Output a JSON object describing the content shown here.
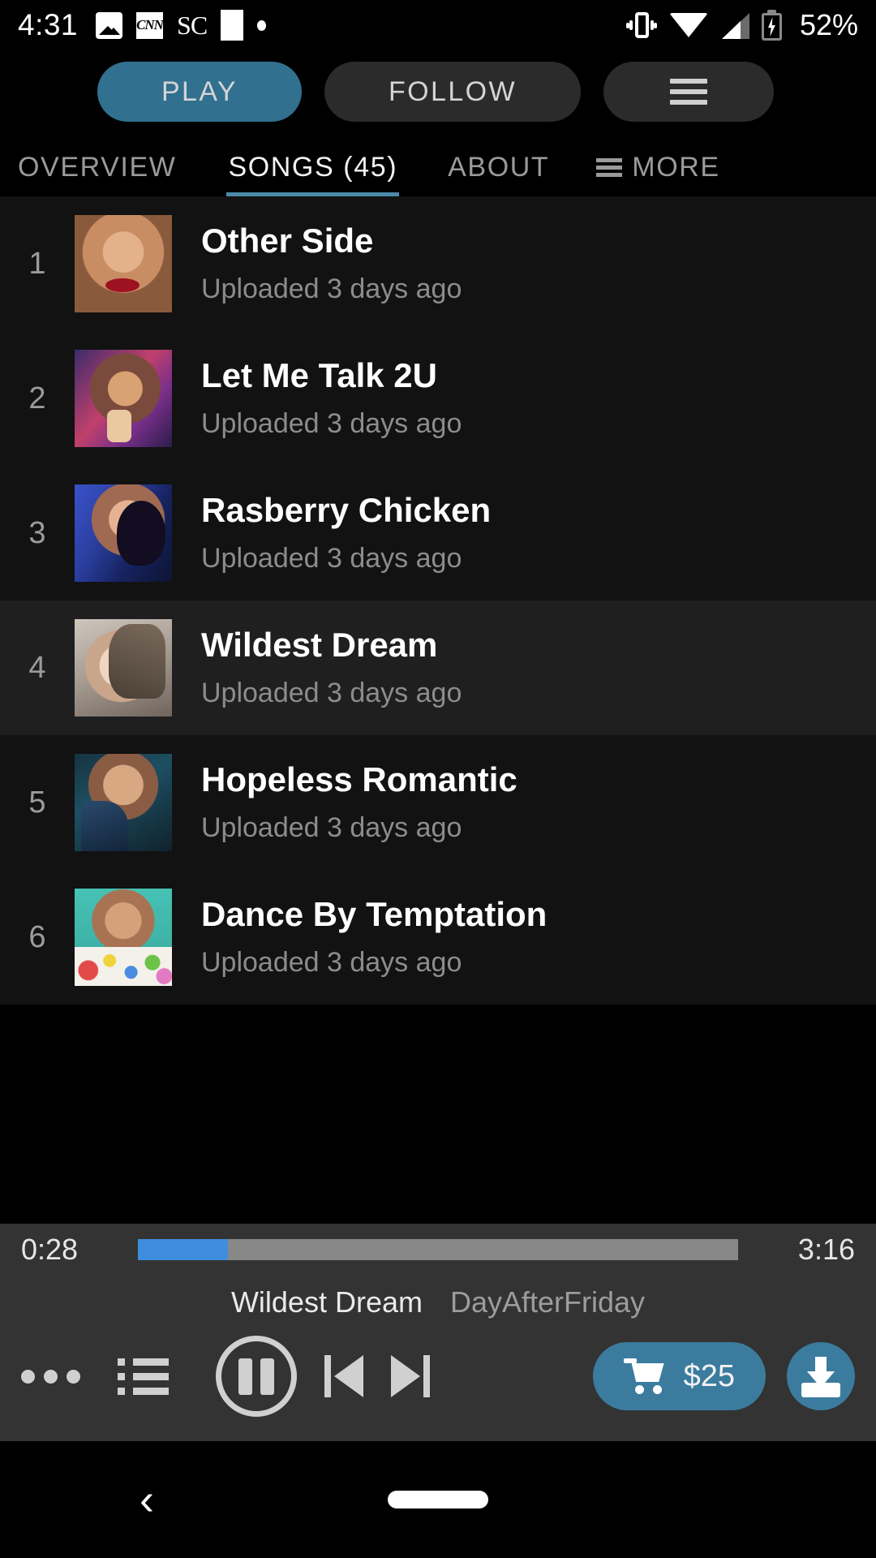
{
  "status_bar": {
    "time": "4:31",
    "battery_percent": "52%",
    "left_icons": [
      "gallery-icon",
      "cnn-icon",
      "sc-icon",
      "app-icon",
      "dot-icon"
    ],
    "cnn_label": "CNN",
    "sc_label": "SC",
    "right_icons": [
      "vibrate-icon",
      "wifi-icon",
      "signal-icon",
      "battery-charging-icon"
    ]
  },
  "action_bar": {
    "play_label": "PLAY",
    "follow_label": "FOLLOW",
    "menu_icon": "hamburger-icon",
    "play_color": "#31708f",
    "secondary_color": "#2b2b2b"
  },
  "tabs": {
    "active_index": 1,
    "accent_color": "#4a89a8",
    "items": [
      {
        "label": "OVERVIEW"
      },
      {
        "label": "SONGS (45)"
      },
      {
        "label": "ABOUT"
      },
      {
        "label": "MORE",
        "icon": "hamburger-icon"
      }
    ]
  },
  "songs": {
    "items": [
      {
        "index": "1",
        "title": "Other Side",
        "subtitle": "Uploaded 3 days ago",
        "highlighted": false
      },
      {
        "index": "2",
        "title": "Let Me Talk 2U",
        "subtitle": "Uploaded 3 days ago",
        "highlighted": false
      },
      {
        "index": "3",
        "title": "Rasberry Chicken",
        "subtitle": "Uploaded 3 days ago",
        "highlighted": false
      },
      {
        "index": "4",
        "title": "Wildest Dream",
        "subtitle": "Uploaded 3 days ago",
        "highlighted": true
      },
      {
        "index": "5",
        "title": "Hopeless Romantic",
        "subtitle": "Uploaded 3 days ago",
        "highlighted": false
      },
      {
        "index": "6",
        "title": "Dance By Temptation",
        "subtitle": "Uploaded 3 days ago",
        "highlighted": false
      }
    ]
  },
  "player": {
    "current_time": "0:28",
    "duration": "3:16",
    "progress_percent": 15,
    "progress_fill_color": "#3f8ede",
    "progress_track_color": "#888888",
    "now_playing_title": "Wildest Dream",
    "now_playing_artist": "DayAfterFriday",
    "controls": {
      "more_icon": "more-dots-icon",
      "queue_icon": "queue-list-icon",
      "playpause_icon": "pause-icon",
      "prev_icon": "skip-previous-icon",
      "next_icon": "skip-next-icon"
    },
    "buy_label": "$25",
    "buy_icon": "cart-icon",
    "buy_color": "#3b7c9e",
    "download_icon": "download-icon"
  },
  "nav_bar": {
    "back_icon": "back-chevron-icon",
    "home_icon": "home-pill-icon"
  }
}
